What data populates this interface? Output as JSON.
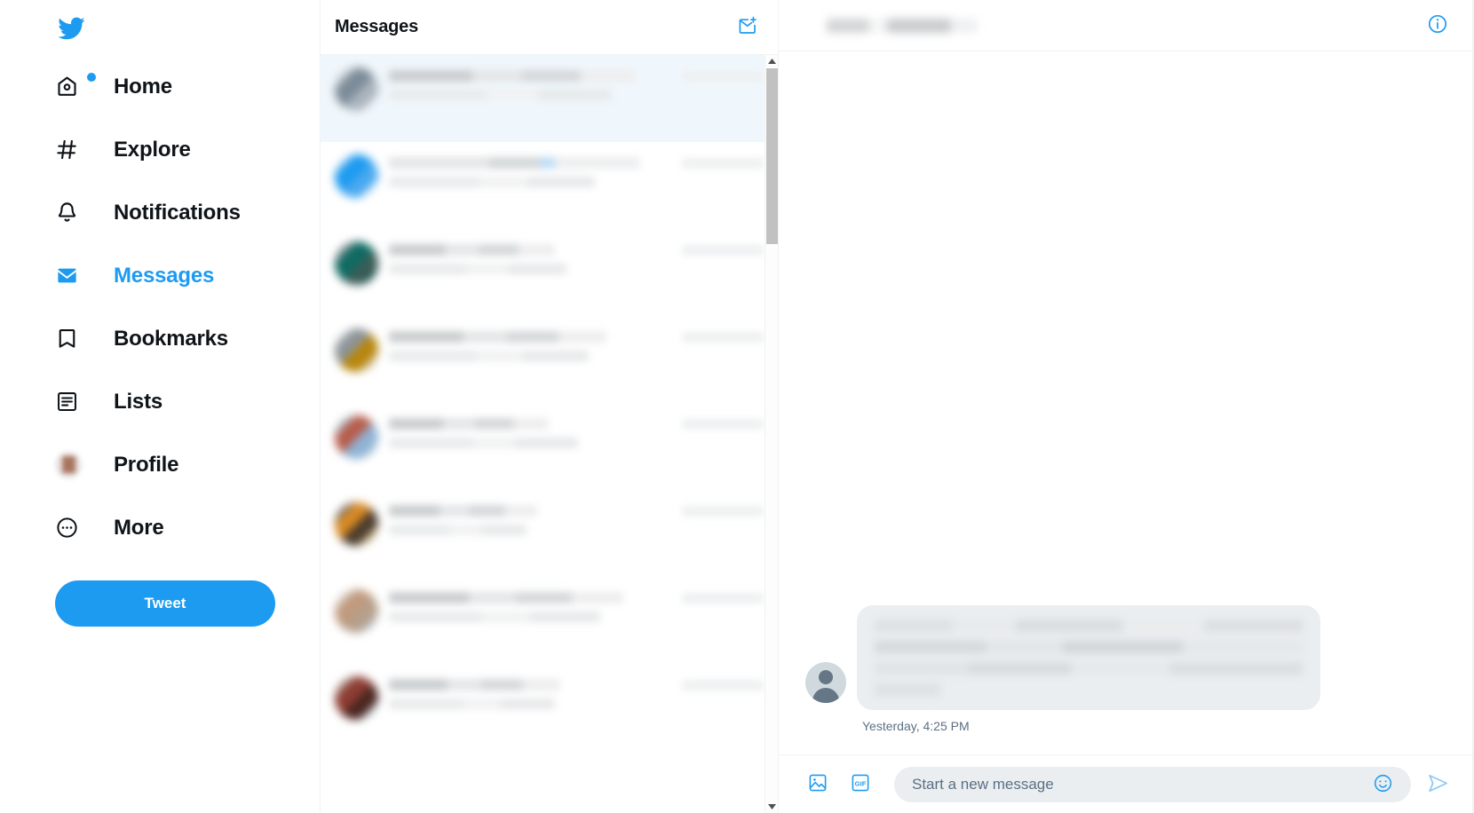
{
  "brand": {
    "logo_icon": "twitter-bird-icon",
    "accent_color": "#1d9bf0",
    "text_color": "#0f1419",
    "muted_color": "#5b7083",
    "divider_color": "#eff3f4"
  },
  "sidebar": {
    "items": [
      {
        "label": "Home",
        "icon": "home-icon",
        "active": false,
        "has_dot": true
      },
      {
        "label": "Explore",
        "icon": "hashtag-icon",
        "active": false,
        "has_dot": false
      },
      {
        "label": "Notifications",
        "icon": "bell-icon",
        "active": false,
        "has_dot": false
      },
      {
        "label": "Messages",
        "icon": "envelope-icon",
        "active": true,
        "has_dot": false
      },
      {
        "label": "Bookmarks",
        "icon": "bookmark-icon",
        "active": false,
        "has_dot": false
      },
      {
        "label": "Lists",
        "icon": "list-icon",
        "active": false,
        "has_dot": false
      },
      {
        "label": "Profile",
        "icon": "profile-avatar-icon",
        "active": false,
        "has_dot": false
      },
      {
        "label": "More",
        "icon": "more-circle-icon",
        "active": false,
        "has_dot": false
      }
    ],
    "tweet_button_label": "Tweet"
  },
  "message_list": {
    "header_title": "Messages",
    "compose_icon": "compose-message-icon",
    "scrollbar": {
      "up_arrow_icon": "scroll-up-arrow-icon",
      "down_arrow_icon": "scroll-down-arrow-icon"
    },
    "conversations": [
      {
        "selected": true,
        "avatar_colors": [
          "#c7ccd1",
          "#7b8b98",
          "#aab4bd",
          "#dfe3e6"
        ]
      },
      {
        "selected": false,
        "avatar_colors": [
          "#bfdcf7",
          "#1d9bf0",
          "#4aa9ef",
          "#cfe6fa"
        ]
      },
      {
        "selected": false,
        "avatar_colors": [
          "#8d9499",
          "#0f6b63",
          "#3d5c58",
          "#0d4a42"
        ]
      },
      {
        "selected": false,
        "avatar_colors": [
          "#c9cdd0",
          "#8d9499",
          "#b8860b",
          "#cdb98a"
        ]
      },
      {
        "selected": false,
        "avatar_colors": [
          "#a8b4bf",
          "#b85c4a",
          "#8fb4d6",
          "#a3bdd4"
        ]
      },
      {
        "selected": false,
        "avatar_colors": [
          "#756f6a",
          "#d98a24",
          "#4a3c2e",
          "#cbb48a"
        ]
      },
      {
        "selected": false,
        "avatar_colors": [
          "#d6cdc3",
          "#c09a7e",
          "#b5a08c",
          "#b9bfc4"
        ]
      },
      {
        "selected": false,
        "avatar_colors": [
          "#a88e82",
          "#8e3d33",
          "#4a2620",
          "#b5bcc1"
        ]
      }
    ]
  },
  "conversation": {
    "header": {
      "title_redacted": true,
      "info_icon": "info-circle-icon"
    },
    "messages": [
      {
        "author_avatar_icon": "default-person-avatar",
        "body_redacted": true,
        "timestamp": "Yesterday, 4:25 PM"
      }
    ],
    "composer": {
      "media_icon": "image-upload-icon",
      "gif_icon": "gif-icon",
      "gif_label": "GIF",
      "placeholder": "Start a new message",
      "value": "",
      "emoji_icon": "emoji-smiley-icon",
      "send_icon": "send-arrow-icon"
    }
  }
}
